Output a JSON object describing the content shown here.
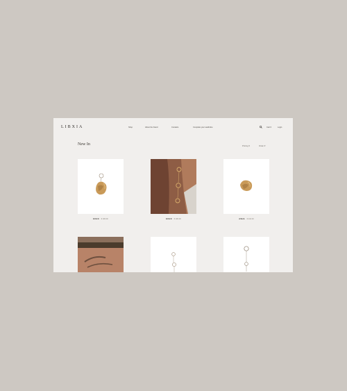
{
  "site": {
    "logo": "LIBXIA",
    "nav": [
      "Shop",
      "About the brand",
      "Contacts",
      "Complete your wardrobe"
    ],
    "search_icon": "search-icon",
    "cart": "Cart 0",
    "login": "Login"
  },
  "collection": {
    "title": "New In",
    "filters": {
      "pricing": "Pricing",
      "order": "Order"
    }
  },
  "products": [
    {
      "name": "ECHO",
      "price": "€ 180.00"
    },
    {
      "name": "ECHO",
      "price": "€ 180.00"
    },
    {
      "name": "ASHA",
      "price": "€ 210.00"
    },
    {
      "name": "",
      "price": ""
    },
    {
      "name": "",
      "price": ""
    },
    {
      "name": "",
      "price": ""
    }
  ],
  "colors": {
    "backdrop": "#cdc8c2",
    "page": "#f1efed",
    "gold": "#c99a58",
    "text": "#3a3631"
  }
}
